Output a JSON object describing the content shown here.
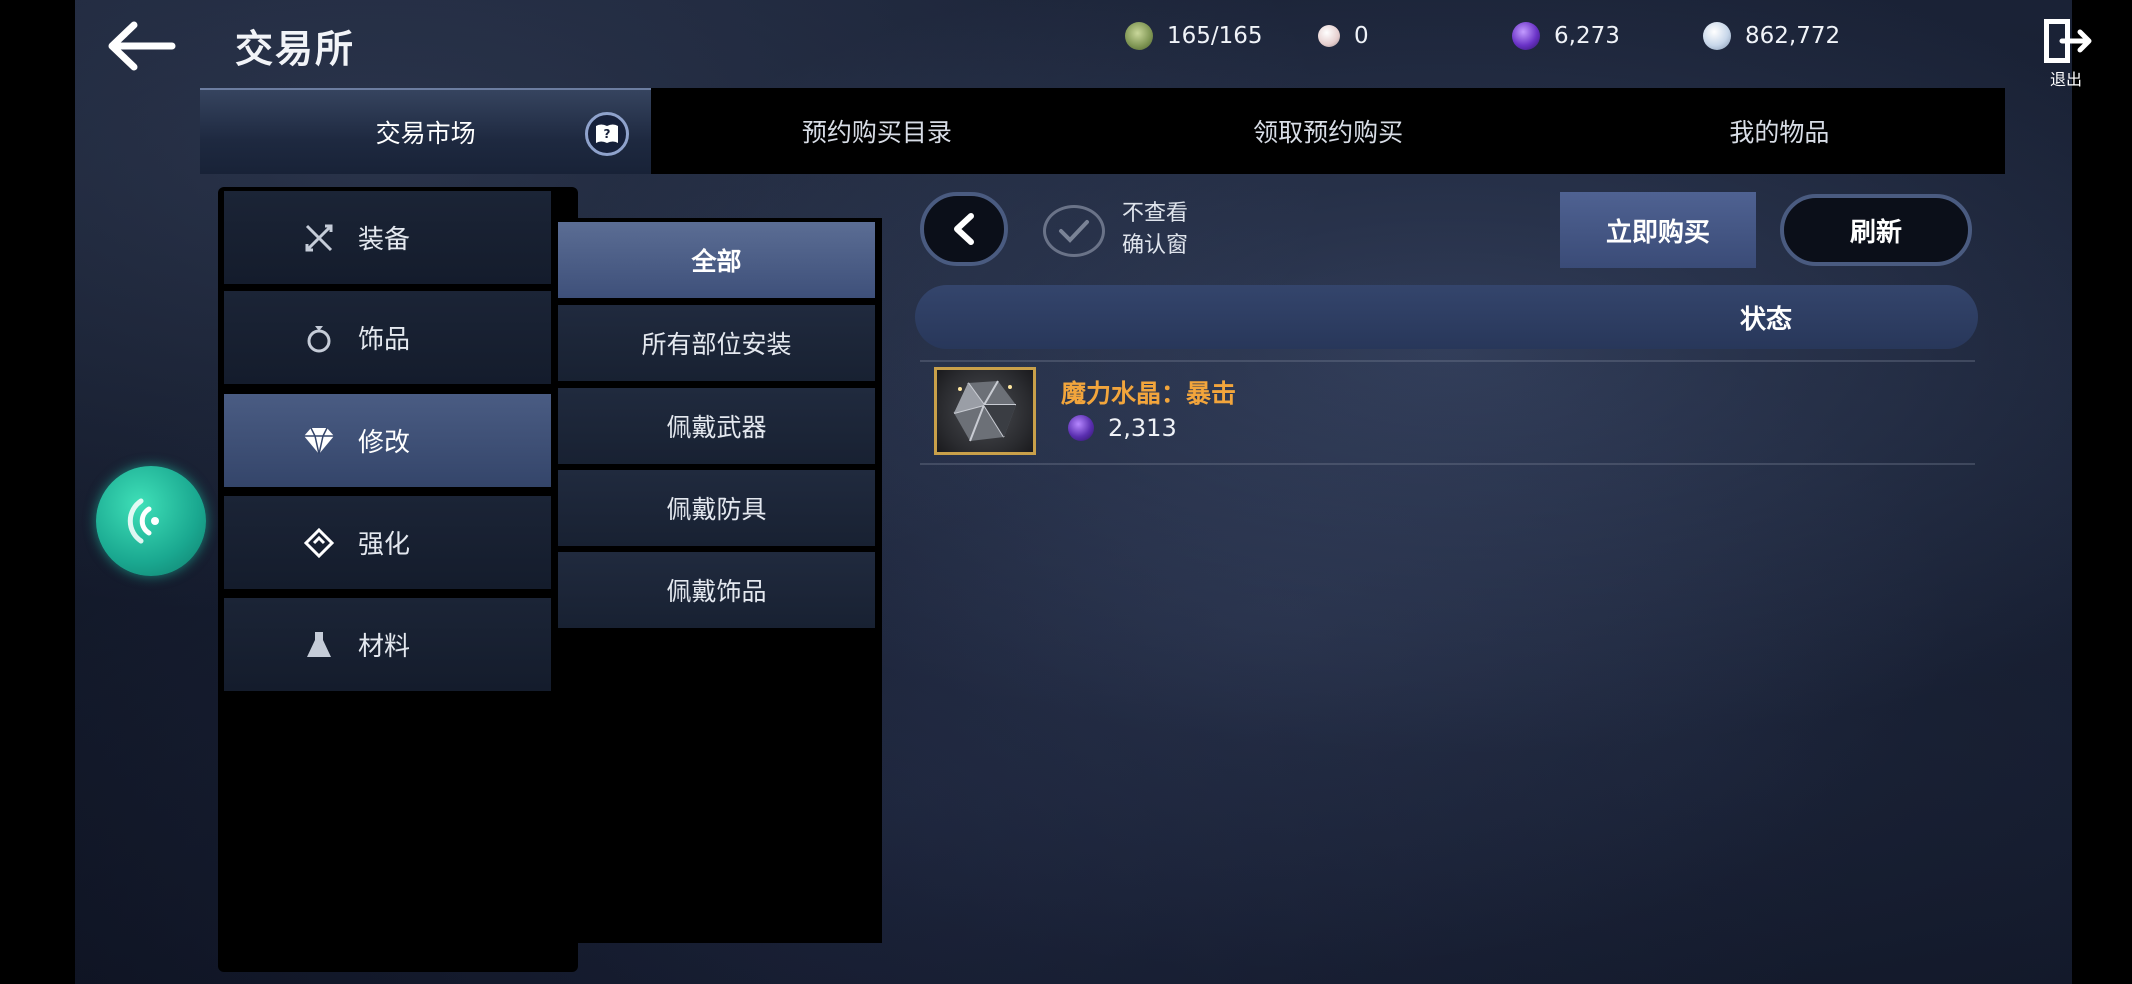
{
  "header": {
    "title": "交易所",
    "exit_label": "退出"
  },
  "currencies": [
    {
      "name": "stamina-icon",
      "value": "165/165",
      "color": "#9fb47a"
    },
    {
      "name": "pearl-icon",
      "value": "0",
      "color": "#e9dede"
    },
    {
      "name": "crystal-orb-icon",
      "value": "6,273",
      "color": "#7e47d8"
    },
    {
      "name": "silver-coin-icon",
      "value": "862,772",
      "color": "#c8d7ea"
    }
  ],
  "tabs": [
    {
      "label": "交易市场",
      "active": true
    },
    {
      "label": "预约购买目录",
      "active": false
    },
    {
      "label": "领取预约购买",
      "active": false
    },
    {
      "label": "我的物品",
      "active": false
    }
  ],
  "categories": [
    {
      "label": "装备",
      "icon": "crossed-swords-icon",
      "active": false
    },
    {
      "label": "饰品",
      "icon": "ring-icon",
      "active": false
    },
    {
      "label": "修改",
      "icon": "diamond-icon",
      "active": true
    },
    {
      "label": "强化",
      "icon": "enhance-icon",
      "active": false
    },
    {
      "label": "材料",
      "icon": "flask-icon",
      "active": false
    }
  ],
  "subcategories": [
    {
      "label": "全部",
      "active": true
    },
    {
      "label": "所有部位安装",
      "active": false
    },
    {
      "label": "佩戴武器",
      "active": false
    },
    {
      "label": "佩戴防具",
      "active": false
    },
    {
      "label": "佩戴饰品",
      "active": false
    }
  ],
  "controls": {
    "check_label_line1": "不查看",
    "check_label_line2": "确认窗",
    "buy_now_label": "立即购买",
    "refresh_label": "刷新",
    "status_header": "状态"
  },
  "items": [
    {
      "name": "魔力水晶：暴击",
      "price": "2,313",
      "frame_color": "#c9a04a",
      "name_color": "#f2a53c"
    }
  ]
}
